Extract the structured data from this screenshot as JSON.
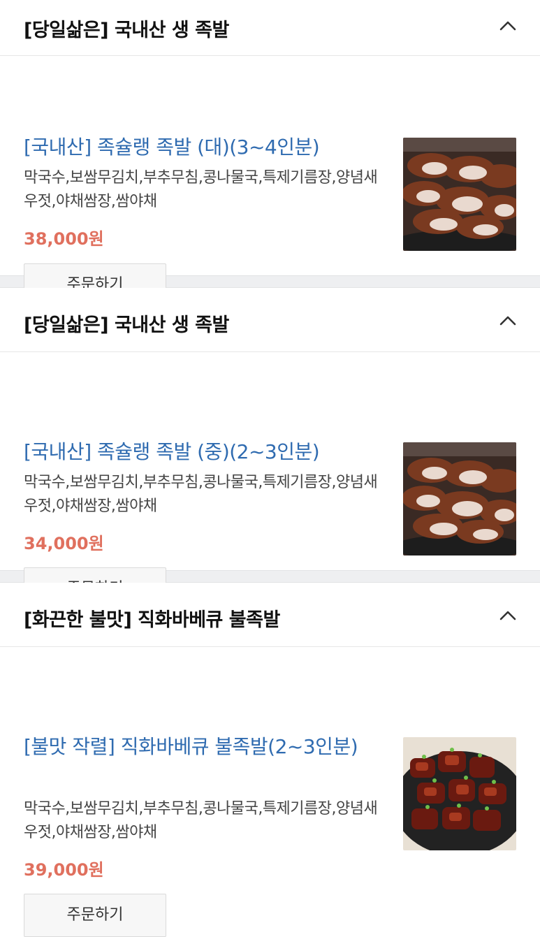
{
  "sections": [
    {
      "title": "[당일삶은] 국내산 생 족발",
      "item": {
        "name": "[국내산] 족슐랭 족발 (대)(3~4인분)",
        "description": "막국수,보쌈무김치,부추무침,콩나물국,특제기름장,양념새우젓,야채쌈장,쌈야채",
        "price": "38,000원",
        "order_label": "주문하기",
        "image": "jokbal-platter"
      }
    },
    {
      "title": "[당일삶은] 국내산 생 족발",
      "item": {
        "name": "[국내산] 족슐랭 족발 (중)(2~3인분)",
        "description": "막국수,보쌈무김치,부추무침,콩나물국,특제기름장,양념새우젓,야채쌈장,쌈야채",
        "price": "34,000원",
        "order_label": "주문하기",
        "image": "jokbal-platter"
      }
    },
    {
      "title": "[화끈한 불맛] 직화바베큐 불족발",
      "item": {
        "name": "[불맛 작렬] 직화바베큐 불족발(2~3인분)",
        "description": "막국수,보쌈무김치,부추무침,콩나물국,특제기름장,양념새우젓,야채쌈장,쌈야채",
        "price": "39,000원",
        "order_label": "주문하기",
        "image": "spicy-bul-jokbal"
      }
    }
  ],
  "colors": {
    "item_name": "#2f6bb0",
    "price": "#e0705e",
    "divider": "#eeeff1"
  },
  "icons": {
    "collapse": "chevron-up-icon"
  }
}
